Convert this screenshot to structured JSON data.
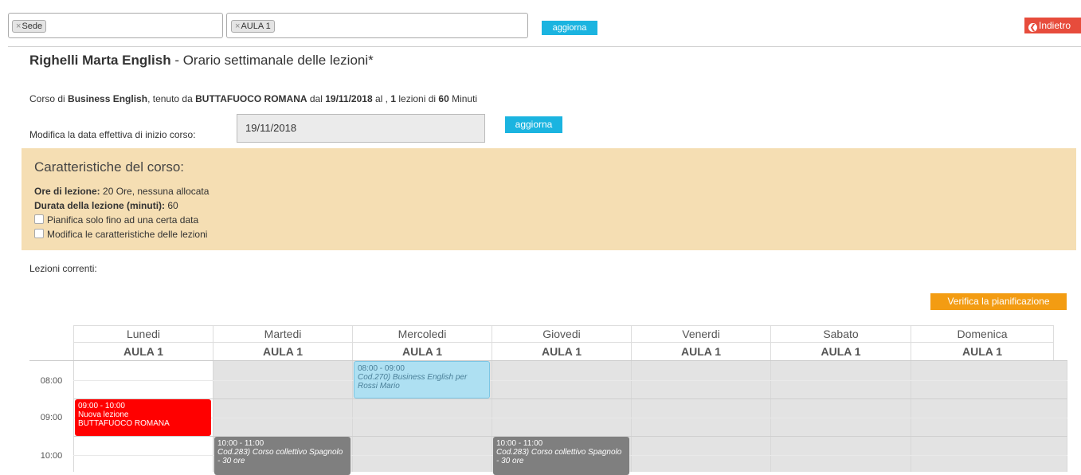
{
  "filters": {
    "sede_tag": "Sede",
    "aula_tag": "AULA 1",
    "remove_glyph": "×",
    "update_button": "aggiorna"
  },
  "back_button": {
    "label": "Indietro",
    "icon": "arrow-left-circle-icon"
  },
  "header": {
    "name": "Righelli Marta English",
    "subtitle": " - Orario settimanale delle lezioni*"
  },
  "course_info": {
    "prefix": "Corso di ",
    "course": "Business English",
    "mid1": ", tenuto da ",
    "teacher": "BUTTAFUOCO ROMANA",
    "mid2": " dal ",
    "date": "19/11/2018",
    "mid3": " al , ",
    "count": "1",
    "mid4": " lezioni di ",
    "minutes": "60",
    "suffix": " Minuti"
  },
  "start_date": {
    "label": "Modifica la data effettiva di inizio corso:",
    "value": "19/11/2018",
    "update_button": "aggiorna"
  },
  "characteristics": {
    "title": "Caratteristiche del corso:",
    "hours_label": "Ore di lezione:",
    "hours_value": " 20 Ore, nessuna allocata",
    "duration_label": "Durata della lezione (minuti):",
    "duration_value": " 60",
    "check1": "Pianifica solo fino ad una certa data",
    "check2": "Modifica le caratteristiche delle lezioni"
  },
  "current_lessons_label": "Lezioni correnti:",
  "verify_button": "Verifica la pianificazione",
  "calendar": {
    "days": [
      "Lunedi",
      "Martedi",
      "Mercoledi",
      "Giovedi",
      "Venerdi",
      "Sabato",
      "Domenica"
    ],
    "room": "AULA 1",
    "times": [
      "08:00",
      "09:00",
      "10:00"
    ],
    "events": [
      {
        "time": "08:00 - 09:00",
        "text": "Cod.270) Business English per Rossi Mario",
        "day": "Mercoledi"
      },
      {
        "time": "09:00 - 10:00",
        "line1": "Nuova lezione",
        "line2": "BUTTAFUOCO ROMANA",
        "day": "Lunedi"
      },
      {
        "time": "10:00 - 11:00",
        "text": "Cod.283) Corso collettivo Spagnolo - 30 ore",
        "day": "Martedi"
      },
      {
        "time": "10:00 - 11:00",
        "text": "Cod.283) Corso collettivo Spagnolo - 30 ore",
        "day": "Giovedi"
      }
    ]
  },
  "colors": {
    "cyan": "#1bb4e0",
    "red": "#e74c3c",
    "orange": "#f39c12",
    "panel": "#f5deb3",
    "event_new": "#ff0000",
    "event_existing": "#7f7f7f",
    "event_other": "#aee0f2"
  }
}
